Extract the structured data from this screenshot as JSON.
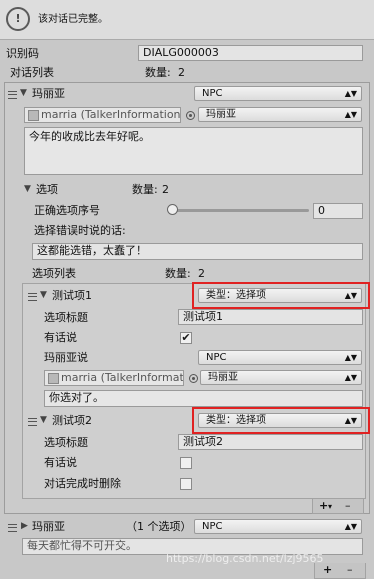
{
  "help_box": {
    "icon": "info-icon",
    "message": "该对话已完整。"
  },
  "id_row": {
    "label": "识别码",
    "value": "DIALG000003"
  },
  "dialog_list": {
    "label": "对话列表",
    "count_label": "数量:",
    "count": "2"
  },
  "talker1": {
    "name": "玛丽亚",
    "type": "NPC",
    "object_ref": "marria (TalkerInformation)",
    "talker_select": "玛丽亚",
    "content": "今年的收成比去年好呢。"
  },
  "options": {
    "label": "选项",
    "count_label": "数量:",
    "count": "2",
    "correct_label": "正确选项序号",
    "correct_value": "0",
    "correct_fraction": 0,
    "wrong_label": "选择错误时说的话:",
    "wrong_text": "这都能选错，太蠢了！",
    "list_label": "选项列表",
    "list_count_label": "数量:",
    "list_count": "2"
  },
  "option1": {
    "name": "测试项1",
    "type": "类型：选择项",
    "title_label": "选项标题",
    "title_value": "测试项1",
    "has_talk_label": "有话说",
    "has_talk_checked": "✔",
    "speaker_label": "玛丽亚说",
    "speaker_type": "NPC",
    "object_ref": "marria (TalkerInformatio",
    "talker_select": "玛丽亚",
    "content": "你选对了。"
  },
  "option2": {
    "name": "测试项2",
    "type": "类型：选择项",
    "title_label": "选项标题",
    "title_value": "测试项2",
    "has_talk_label": "有话说",
    "delete_label": "对话完成时删除"
  },
  "list_controls": {
    "add": "+",
    "add_more": "▾",
    "remove": "–"
  },
  "talker2": {
    "name": "玛丽亚",
    "options_count": "（1 个选项）",
    "type": "NPC",
    "content": "每天都忙得不可开交。"
  },
  "bottom_controls": {
    "add": "+",
    "remove": "–"
  },
  "watermark": "https://blog.csdn.net/lzj9565"
}
